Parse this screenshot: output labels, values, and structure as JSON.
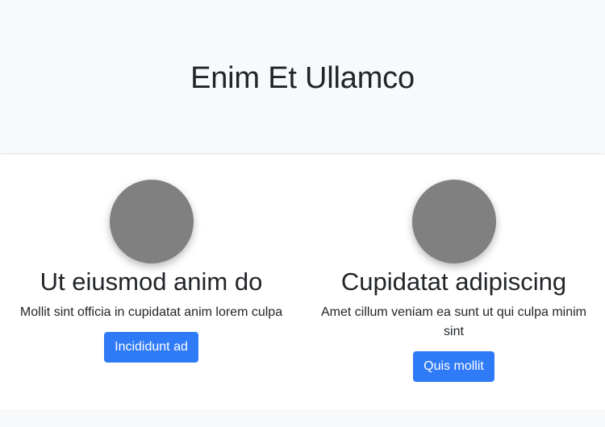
{
  "hero": {
    "title": "Enim Et Ullamco"
  },
  "cards": [
    {
      "heading": "Ut eiusmod anim do",
      "text": "Mollit sint officia in cupidatat anim lorem culpa",
      "button_label": "Incididunt ad"
    },
    {
      "heading": "Cupidatat adipiscing",
      "text": "Amet cillum veniam ea sunt ut qui culpa minim sint",
      "button_label": "Quis mollit"
    }
  ],
  "colors": {
    "hero_bg": "#f8f9fa",
    "avatar": "#808080",
    "button": "#2f7af7",
    "text": "#212529"
  }
}
